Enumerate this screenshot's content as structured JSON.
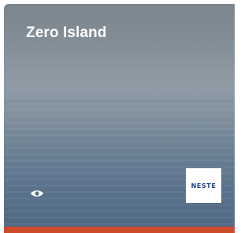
{
  "card": {
    "title": "Zero Island",
    "logo_text": "NESTE",
    "views_icon": "eye-icon",
    "accent_color": "#cf4b2e",
    "logo_color": "#1b3f8c"
  }
}
